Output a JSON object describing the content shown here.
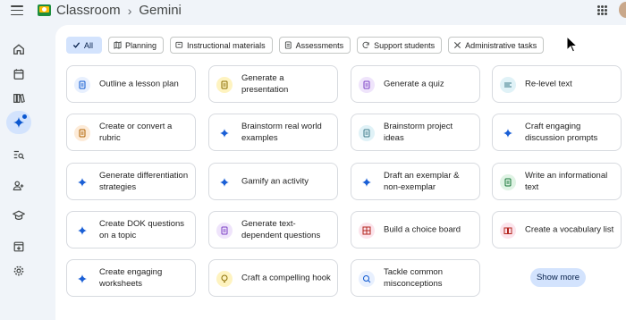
{
  "header": {
    "app_title": "Classroom",
    "page_title": "Gemini"
  },
  "sidebar": {
    "items": [
      {
        "name": "home-icon"
      },
      {
        "name": "calendar-icon"
      },
      {
        "name": "library-icon"
      },
      {
        "name": "gemini-sparkle-icon",
        "active": true
      },
      {
        "name": "review-icon"
      },
      {
        "name": "people-icon"
      },
      {
        "name": "graduation-cap-icon"
      },
      {
        "name": "archive-icon"
      },
      {
        "name": "settings-icon"
      }
    ]
  },
  "filters": [
    {
      "label": "All",
      "icon": "check-icon",
      "selected": true
    },
    {
      "label": "Planning",
      "icon": "map-icon"
    },
    {
      "label": "Instructional materials",
      "icon": "slides-icon"
    },
    {
      "label": "Assessments",
      "icon": "document-icon"
    },
    {
      "label": "Support students",
      "icon": "refresh-icon"
    },
    {
      "label": "Administrative tasks",
      "icon": "tools-icon"
    }
  ],
  "tools": [
    {
      "label": "Outline a lesson plan",
      "icon": "outline-icon",
      "color": "blue"
    },
    {
      "label": "Generate a presentation",
      "icon": "presentation-icon",
      "color": "yellow"
    },
    {
      "label": "Generate a quiz",
      "icon": "quiz-icon",
      "color": "purple"
    },
    {
      "label": "Re-level text",
      "icon": "text-lines-icon",
      "color": "teal"
    },
    {
      "label": "Create or convert a rubric",
      "icon": "rubric-icon",
      "color": "orange"
    },
    {
      "label": "Brainstorm real world examples",
      "icon": "sparkle-icon",
      "color": "star"
    },
    {
      "label": "Brainstorm project ideas",
      "icon": "project-icon",
      "color": "teal"
    },
    {
      "label": "Craft engaging discussion prompts",
      "icon": "sparkle-icon",
      "color": "star"
    },
    {
      "label": "Generate differentiation strategies",
      "icon": "sparkle-icon",
      "color": "star"
    },
    {
      "label": "Gamify an activity",
      "icon": "sparkle-icon",
      "color": "star"
    },
    {
      "label": "Draft an exemplar & non-exemplar",
      "icon": "sparkle-icon",
      "color": "star"
    },
    {
      "label": "Write an informational text",
      "icon": "document-icon",
      "color": "green"
    },
    {
      "label": "Create DOK questions on a topic",
      "icon": "sparkle-icon",
      "color": "star"
    },
    {
      "label": "Generate text-dependent questions",
      "icon": "text-questions-icon",
      "color": "purple"
    },
    {
      "label": "Build a choice board",
      "icon": "grid-board-icon",
      "color": "pink"
    },
    {
      "label": "Create a vocabulary list",
      "icon": "book-icon",
      "color": "pink"
    },
    {
      "label": "Create engaging worksheets",
      "icon": "sparkle-icon",
      "color": "star"
    },
    {
      "label": "Craft a compelling hook",
      "icon": "lightbulb-icon",
      "color": "yellow"
    },
    {
      "label": "Tackle common misconceptions",
      "icon": "search-icon",
      "color": "blue"
    }
  ],
  "show_more_label": "Show more",
  "colors": {
    "accent": "#0b57d0",
    "chip_selected_bg": "#d3e3fd",
    "page_bg": "#f0f4f9"
  }
}
